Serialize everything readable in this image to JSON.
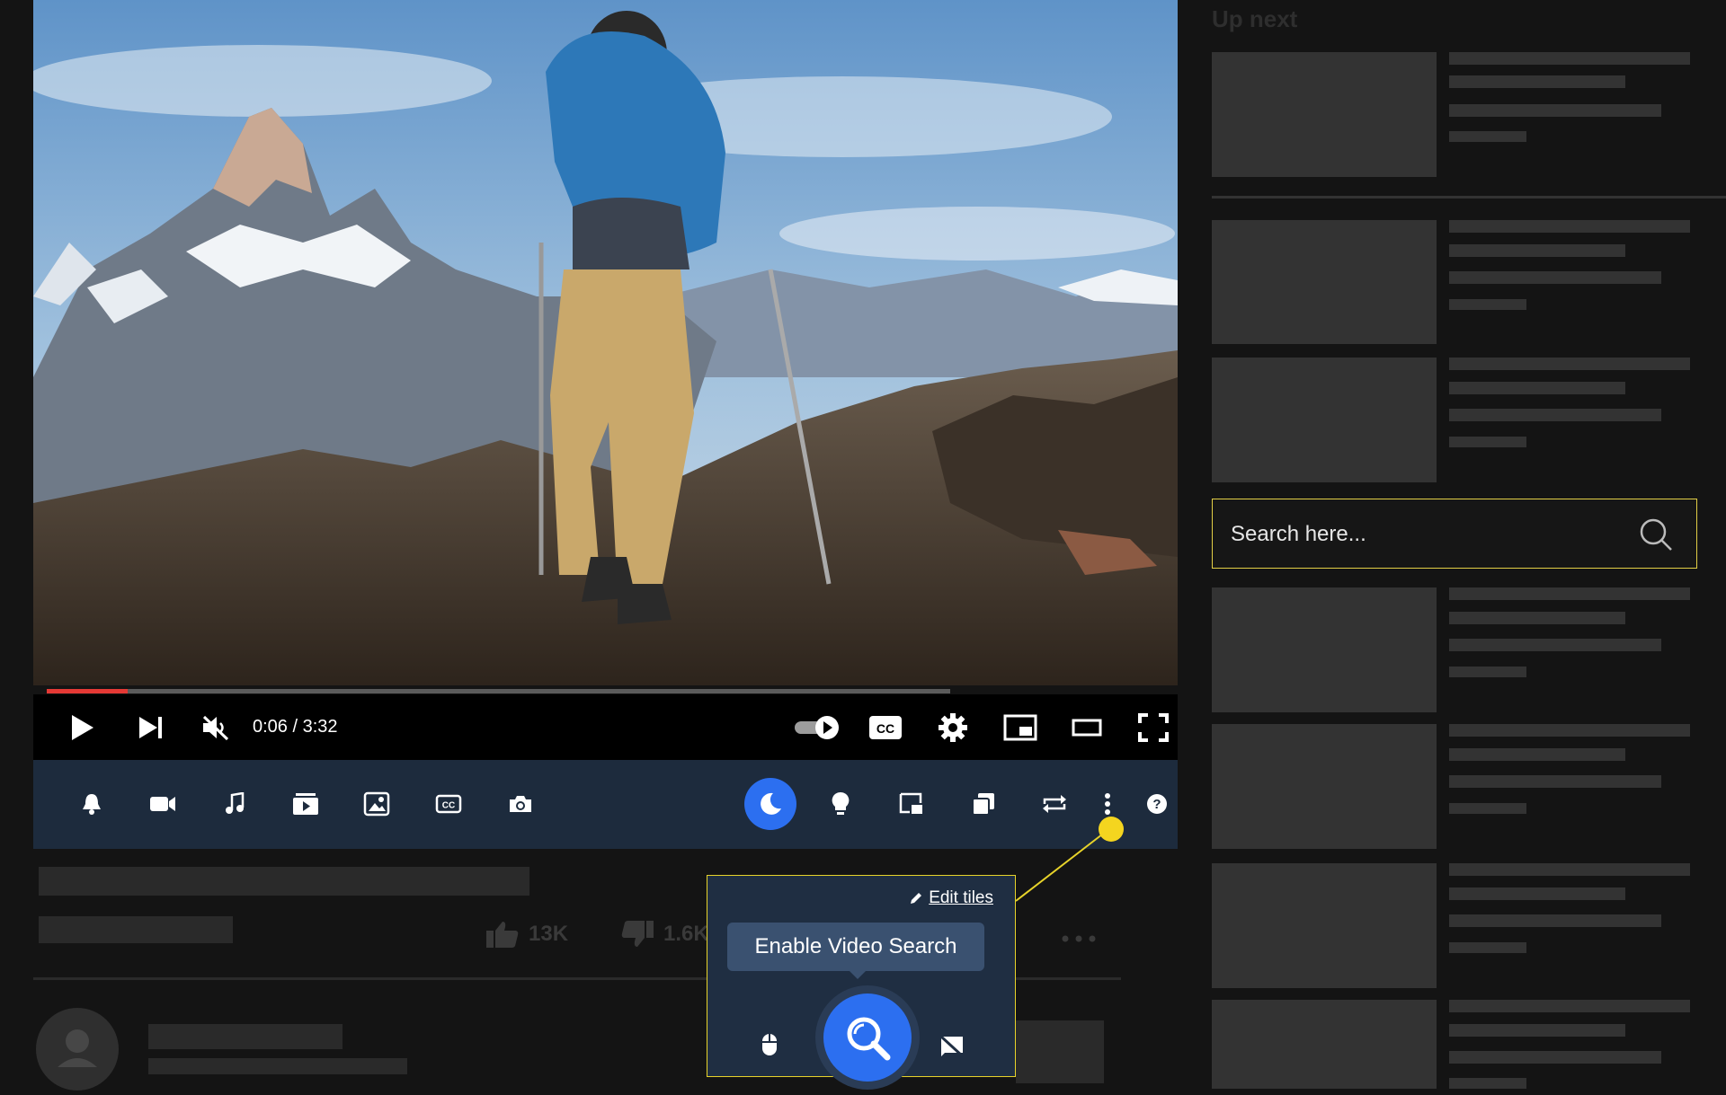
{
  "player": {
    "time_display": "0:06 / 3:32",
    "progress_fraction": 0.0714,
    "buffered_fraction": 0.8,
    "accent_color": "#e53935",
    "controls": [
      "play-icon",
      "next-icon",
      "mute-icon",
      "autoplay-toggle",
      "cc-icon",
      "settings-icon",
      "miniplayer-icon",
      "theater-icon",
      "fullscreen-icon"
    ]
  },
  "extension_bar": {
    "tiles": [
      "bell-icon",
      "camera-icon",
      "music-icon",
      "playlist-icon",
      "image-icon",
      "cc-icon",
      "screenshot-icon",
      "dark-mode-icon",
      "lightbulb-icon",
      "pip-icon",
      "copy-icon",
      "loop-icon",
      "more-icon",
      "help-icon"
    ],
    "active_color": "#2c6ff0"
  },
  "video_meta": {
    "likes": "13K",
    "dislikes": "1.6K"
  },
  "popup": {
    "edit_tiles_label": "Edit tiles",
    "tooltip": "Enable Video Search",
    "tiles": [
      "mouse-icon",
      "video-search-icon",
      "no-comments-icon"
    ],
    "highlight_color": "#e7d32a"
  },
  "sidebar": {
    "heading": "Up next",
    "search_placeholder": "Search here..."
  }
}
